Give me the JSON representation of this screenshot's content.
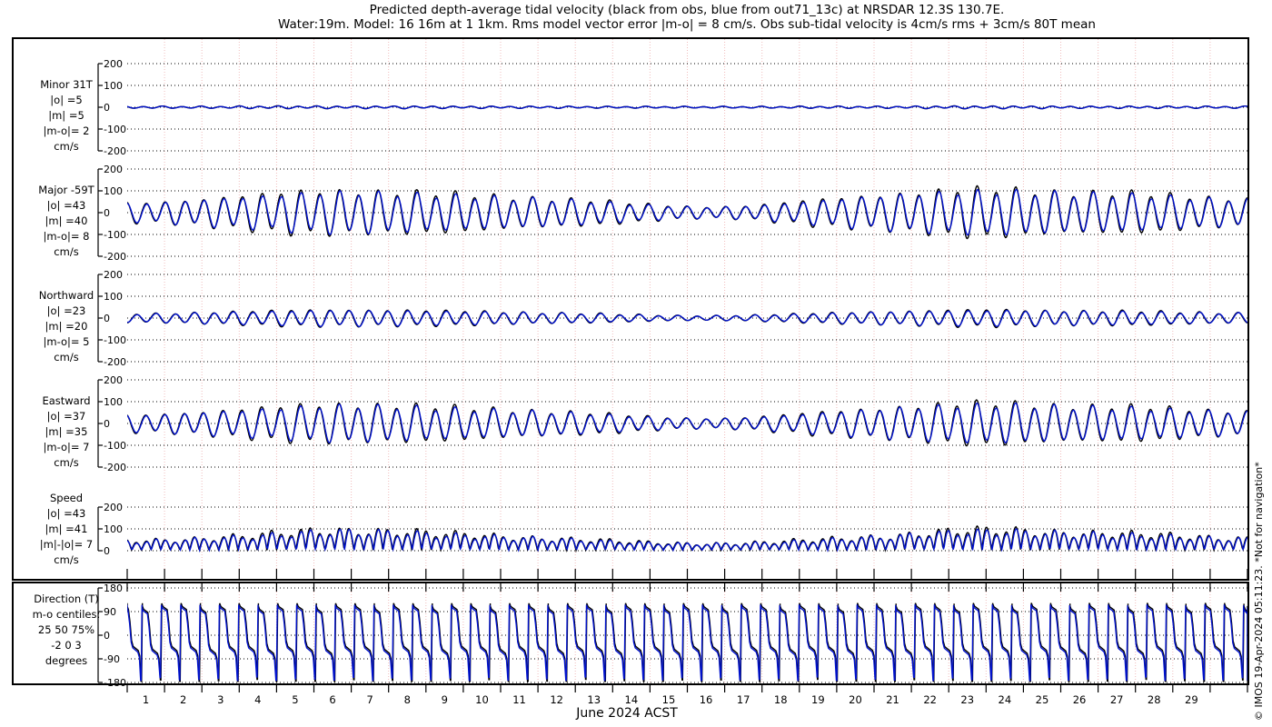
{
  "title": {
    "line1": "Predicted depth-average tidal velocity (black from obs, blue from out71_13c) at NRSDAR 12.3S 130.7E.",
    "line2": "Water:19m. Model: 16 16m at 1 1km. Rms model vector error |m-o| = 8 cm/s. Obs sub-tidal velocity is 4cm/s rms + 3cm/s 80T mean"
  },
  "watermark": "© IMOS 19-Apr-2024 05:11:23. *Not for navigation*",
  "colors": {
    "obs": "#000000",
    "model": "#0011cc",
    "h_grid": "#000000",
    "v_grid": "#f0bcbc",
    "frame": "#000000",
    "text": "#000000"
  },
  "xaxis": {
    "label": "June 2024 ACST",
    "day_labels": [
      1,
      2,
      3,
      4,
      5,
      6,
      7,
      8,
      9,
      10,
      11,
      12,
      13,
      14,
      15,
      16,
      17,
      18,
      19,
      20,
      21,
      22,
      23,
      24,
      25,
      26,
      27,
      28,
      29
    ],
    "n_days": 30
  },
  "chart_data": {
    "type": "line",
    "x_unit": "day of June 2024 (ACST)",
    "x_range": [
      0,
      30
    ],
    "tidal_period_days": 0.5175,
    "legend": [
      {
        "name": "observations",
        "color_key": "obs"
      },
      {
        "name": "model out71_13c",
        "color_key": "model"
      }
    ],
    "panels": [
      {
        "id": "minor",
        "heading": "Minor 31T",
        "stat_lines": [
          "|o| =5",
          "|m| =5",
          "|m-o|= 2"
        ],
        "units": "cm/s",
        "ylim": [
          -200,
          200
        ],
        "yticks": [
          200,
          100,
          0,
          -100,
          -200
        ],
        "daily_amplitude": [
          5,
          5,
          5,
          6,
          6,
          6,
          6,
          6,
          5,
          5,
          5,
          5,
          4,
          4,
          4,
          4,
          4,
          4,
          5,
          5,
          5,
          6,
          6,
          6,
          6,
          5,
          5,
          5,
          5,
          5
        ],
        "phase": 1.0,
        "diurnal_phase": 0.5,
        "diurnal_frac": 0.25
      },
      {
        "id": "major",
        "heading": "Major -59T",
        "stat_lines": [
          "|o| =43",
          "|m| =40",
          "|m-o|= 8"
        ],
        "units": "cm/s",
        "ylim": [
          -200,
          200
        ],
        "yticks": [
          200,
          100,
          0,
          -100,
          -200
        ],
        "daily_amplitude": [
          45,
          55,
          68,
          78,
          92,
          100,
          98,
          92,
          85,
          78,
          70,
          64,
          55,
          42,
          32,
          26,
          30,
          42,
          58,
          72,
          85,
          95,
          103,
          105,
          98,
          92,
          90,
          82,
          72,
          65
        ],
        "phase": 0.0,
        "diurnal_phase": 1.2,
        "diurnal_frac": 0.14
      },
      {
        "id": "northward",
        "heading": "Northward",
        "stat_lines": [
          "|o| =23",
          "|m| =20",
          "|m-o|= 5"
        ],
        "units": "cm/s",
        "ylim": [
          -200,
          200
        ],
        "yticks": [
          200,
          100,
          0,
          -100,
          -200
        ],
        "daily_amplitude": [
          20,
          24,
          28,
          31,
          35,
          38,
          37,
          35,
          32,
          30,
          27,
          24,
          21,
          16,
          12,
          11,
          13,
          17,
          22,
          27,
          31,
          34,
          36,
          37,
          35,
          33,
          32,
          29,
          26,
          24
        ],
        "phase": 3.1,
        "diurnal_phase": 2.0,
        "diurnal_frac": 0.14
      },
      {
        "id": "eastward",
        "heading": "Eastward",
        "stat_lines": [
          "|o| =37",
          "|m| =35",
          "|m-o|= 7"
        ],
        "units": "cm/s",
        "ylim": [
          -200,
          200
        ],
        "yticks": [
          200,
          100,
          0,
          -100,
          -200
        ],
        "daily_amplitude": [
          40,
          48,
          58,
          67,
          80,
          88,
          86,
          82,
          74,
          68,
          61,
          55,
          47,
          36,
          27,
          23,
          27,
          37,
          50,
          62,
          74,
          83,
          90,
          92,
          86,
          80,
          78,
          72,
          63,
          57
        ],
        "phase": 0.2,
        "diurnal_phase": 1.4,
        "diurnal_frac": 0.14
      },
      {
        "id": "speed",
        "heading": "Speed",
        "stat_lines": [
          "|o| =43",
          "|m| =41",
          "|m|-|o|= 7"
        ],
        "units": "cm/s",
        "ylim": [
          0,
          200
        ],
        "yticks": [
          200,
          100,
          0
        ],
        "daily_amplitude": [
          50,
          56,
          66,
          76,
          92,
          102,
          100,
          94,
          82,
          76,
          66,
          60,
          52,
          43,
          37,
          34,
          37,
          44,
          54,
          64,
          74,
          90,
          100,
          102,
          95,
          88,
          84,
          78,
          70,
          62
        ],
        "phase": 0.0,
        "diurnal_phase": 1.2,
        "diurnal_frac": 0.18
      },
      {
        "id": "direction",
        "heading": "Direction (T)",
        "stat_lines": [
          "m-o centiles:",
          "25 50 75%",
          "-2 0 3"
        ],
        "units": "degrees",
        "ylim": [
          -180,
          180
        ],
        "yticks": [
          180,
          90,
          0,
          -90,
          -180
        ],
        "profile": [
          [
            0.0,
            112
          ],
          [
            0.06,
            100
          ],
          [
            0.28,
            88
          ],
          [
            0.36,
            40
          ],
          [
            0.44,
            -30
          ],
          [
            0.52,
            -52
          ],
          [
            0.78,
            -68
          ],
          [
            0.86,
            -88
          ],
          [
            0.93,
            -158
          ],
          [
            0.955,
            -158
          ],
          [
            1.0,
            112
          ]
        ],
        "period_days": 0.5175
      }
    ]
  }
}
